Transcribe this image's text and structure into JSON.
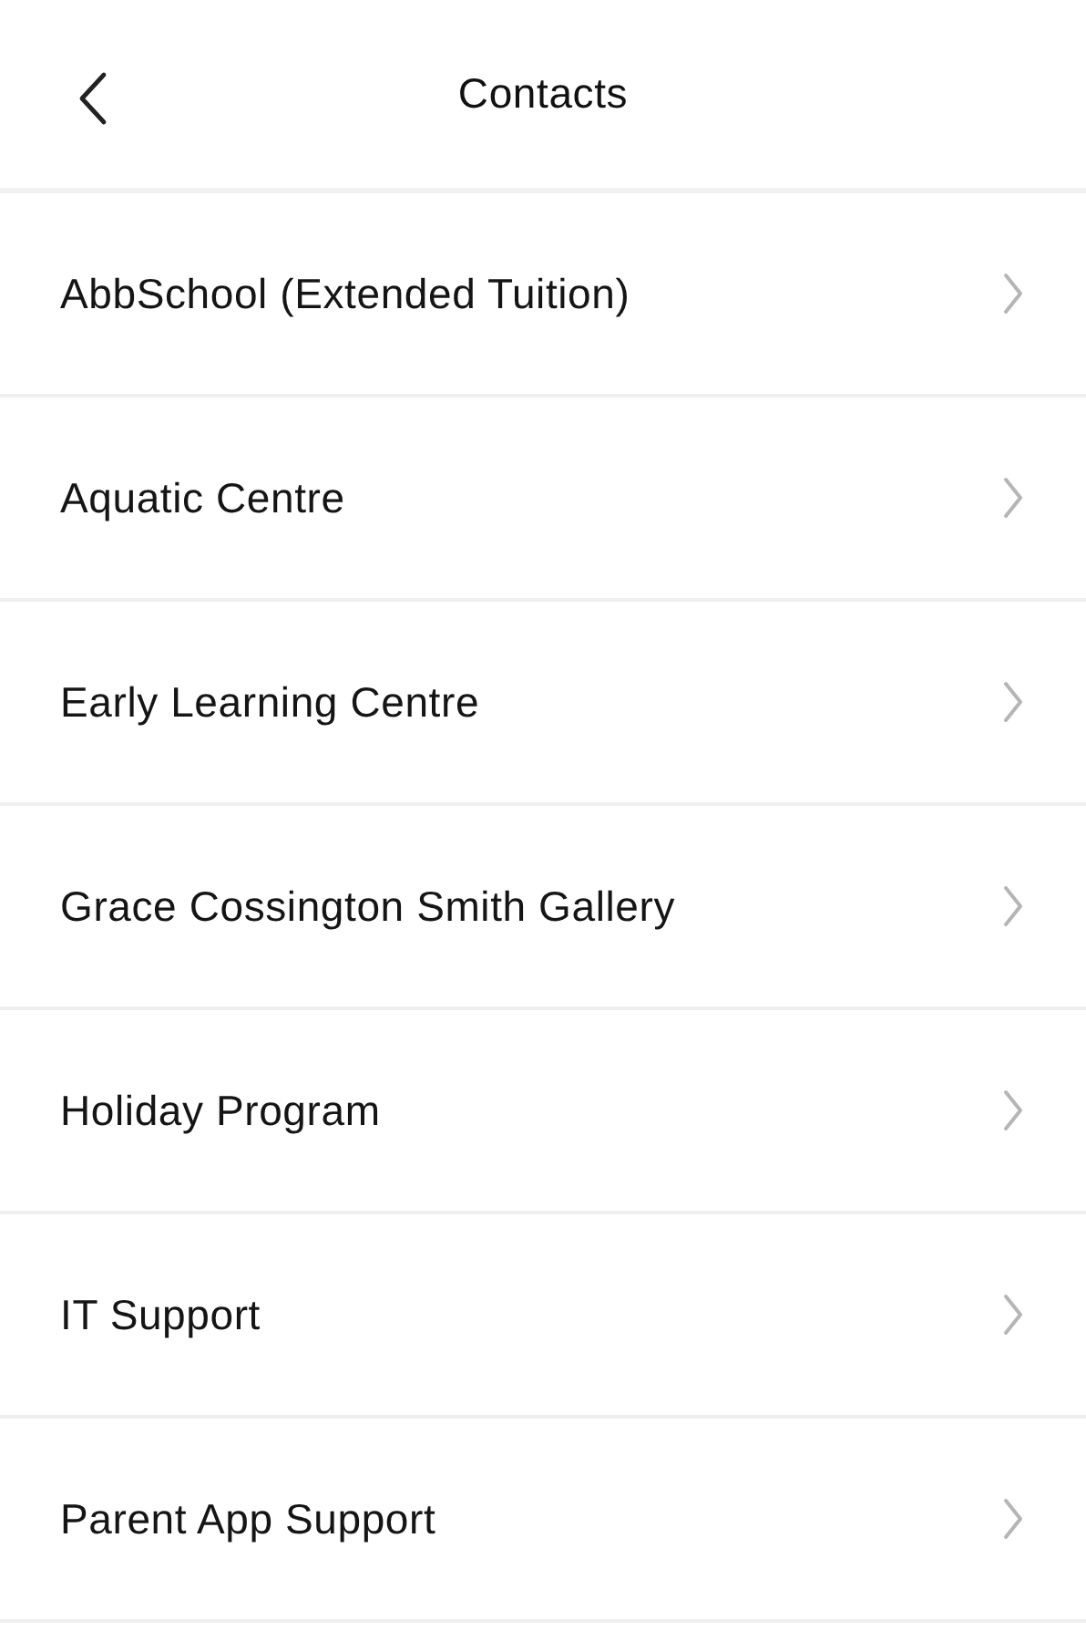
{
  "header": {
    "title": "Contacts"
  },
  "contacts": [
    {
      "name": "AbbSchool (Extended Tuition)"
    },
    {
      "name": "Aquatic Centre"
    },
    {
      "name": "Early Learning Centre"
    },
    {
      "name": "Grace Cossington Smith Gallery"
    },
    {
      "name": "Holiday Program"
    },
    {
      "name": "IT Support"
    },
    {
      "name": "Parent App Support"
    }
  ]
}
